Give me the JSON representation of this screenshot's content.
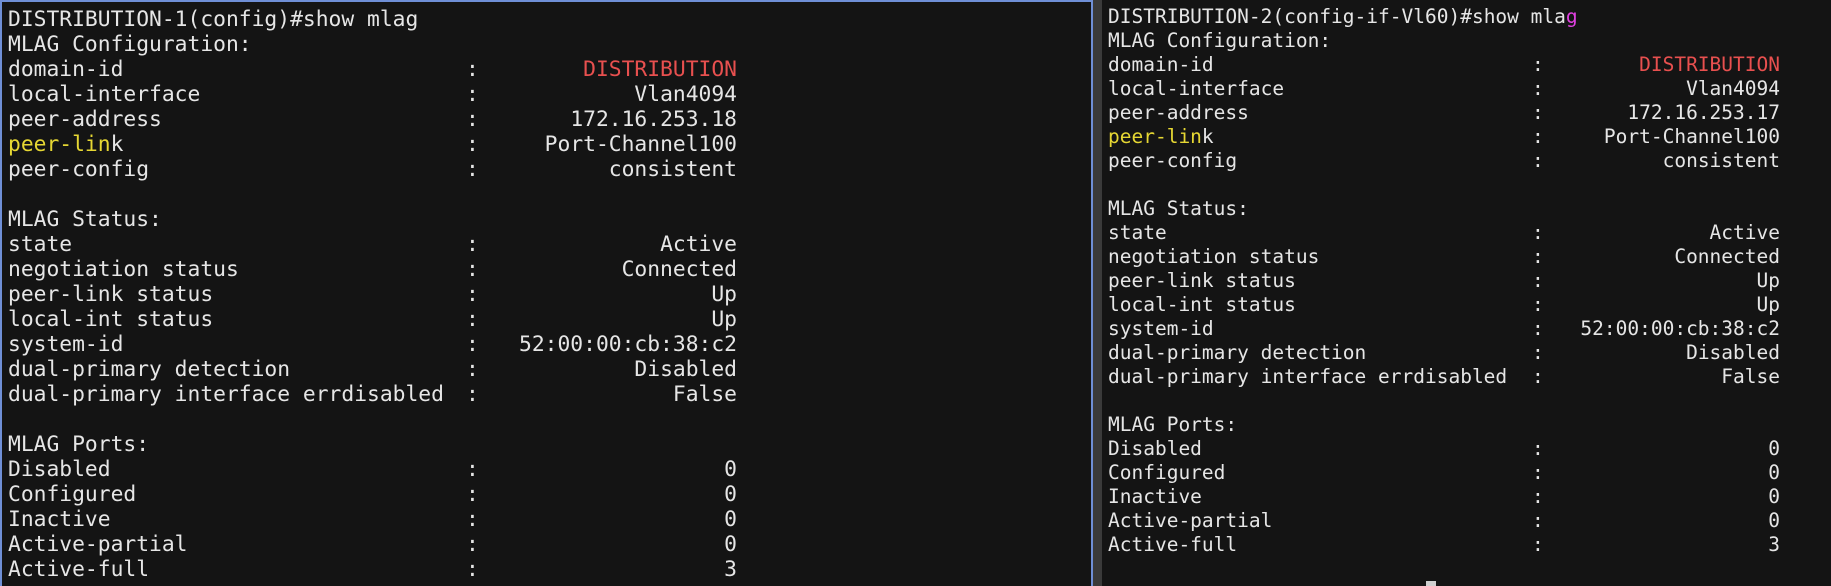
{
  "panes": [
    {
      "prompt": "DISTRIBUTION-1(config)#",
      "command_main": "show mlag",
      "command_tail": "",
      "sections": [
        {
          "heading": "MLAG Configuration:",
          "rows": [
            {
              "label": "domain-id",
              "value": "DISTRIBUTION",
              "value_color": "red"
            },
            {
              "label": "local-interface",
              "value": "Vlan4094"
            },
            {
              "label": "peer-address",
              "value": "172.16.253.18"
            },
            {
              "label_hl": "peer-lin",
              "label_rest": "k",
              "value": "Port-Channel100"
            },
            {
              "label": "peer-config",
              "value": "consistent"
            }
          ]
        },
        {
          "heading": "MLAG Status:",
          "rows": [
            {
              "label": "state",
              "value": "Active"
            },
            {
              "label": "negotiation status",
              "value": "Connected"
            },
            {
              "label": "peer-link status",
              "value": "Up"
            },
            {
              "label": "local-int status",
              "value": "Up"
            },
            {
              "label": "system-id",
              "value": "52:00:00:cb:38:c2"
            },
            {
              "label": "dual-primary detection",
              "value": "Disabled"
            },
            {
              "label": "dual-primary interface errdisabled",
              "value": "False"
            }
          ]
        },
        {
          "heading": "MLAG Ports:",
          "rows": [
            {
              "label": "Disabled",
              "value": "0"
            },
            {
              "label": "Configured",
              "value": "0"
            },
            {
              "label": "Inactive",
              "value": "0"
            },
            {
              "label": "Active-partial",
              "value": "0"
            },
            {
              "label": "Active-full",
              "value": "3"
            }
          ]
        }
      ]
    },
    {
      "prompt": "DISTRIBUTION-2(config-if-Vl60)#",
      "command_main": "show mla",
      "command_tail": "g",
      "sections": [
        {
          "heading": "MLAG Configuration:",
          "rows": [
            {
              "label": "domain-id",
              "value": "DISTRIBUTION",
              "value_color": "red"
            },
            {
              "label": "local-interface",
              "value": "Vlan4094"
            },
            {
              "label": "peer-address",
              "value": "172.16.253.17"
            },
            {
              "label_hl": "peer-lin",
              "label_rest": "k",
              "value": "Port-Channel100"
            },
            {
              "label": "peer-config",
              "value": "consistent"
            }
          ]
        },
        {
          "heading": "MLAG Status:",
          "rows": [
            {
              "label": "state",
              "value": "Active"
            },
            {
              "label": "negotiation status",
              "value": "Connected"
            },
            {
              "label": "peer-link status",
              "value": "Up"
            },
            {
              "label": "local-int status",
              "value": "Up"
            },
            {
              "label": "system-id",
              "value": "52:00:00:cb:38:c2"
            },
            {
              "label": "dual-primary detection",
              "value": "Disabled"
            },
            {
              "label": "dual-primary interface errdisabled",
              "value": "False"
            }
          ]
        },
        {
          "heading": "MLAG Ports:",
          "rows": [
            {
              "label": "Disabled",
              "value": "0"
            },
            {
              "label": "Configured",
              "value": "0"
            },
            {
              "label": "Inactive",
              "value": "0"
            },
            {
              "label": "Active-partial",
              "value": "0"
            },
            {
              "label": "Active-full",
              "value": "3"
            }
          ]
        }
      ]
    }
  ],
  "separator": ":",
  "colors": {
    "background": "#141414",
    "text": "#e6e6e6",
    "domain_value": "#e8504f",
    "highlight": "#e6d733",
    "typed_char": "#e040e0",
    "active_pane_border": "#6f8fd6"
  }
}
